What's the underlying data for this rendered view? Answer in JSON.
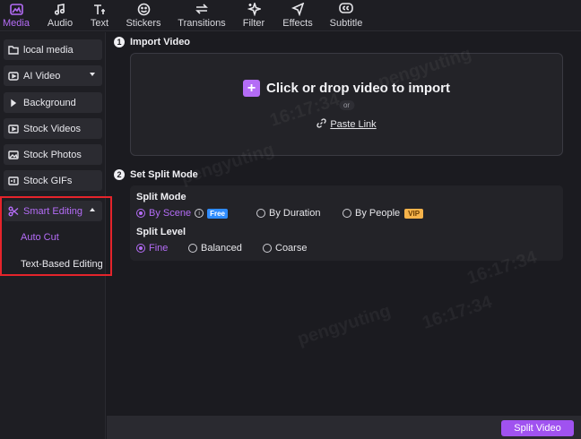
{
  "toolbar": {
    "tabs": [
      {
        "label": "Media",
        "icon": "media-icon"
      },
      {
        "label": "Audio",
        "icon": "audio-icon"
      },
      {
        "label": "Text",
        "icon": "text-icon"
      },
      {
        "label": "Stickers",
        "icon": "stickers-icon"
      },
      {
        "label": "Transitions",
        "icon": "transitions-icon"
      },
      {
        "label": "Filter",
        "icon": "filter-icon"
      },
      {
        "label": "Effects",
        "icon": "effects-icon"
      },
      {
        "label": "Subtitle",
        "icon": "subtitle-icon"
      }
    ],
    "active_tab": "Media"
  },
  "sidebar": {
    "items": [
      {
        "label": "local media",
        "icon": "folder-icon"
      },
      {
        "label": "AI Video",
        "icon": "ai-video-icon"
      },
      {
        "label": "Background",
        "icon": "triangle-right-icon"
      },
      {
        "label": "Stock Videos",
        "icon": "video-icon"
      },
      {
        "label": "Stock Photos",
        "icon": "photo-icon"
      },
      {
        "label": "Stock GIFs",
        "icon": "gif-icon"
      },
      {
        "label": "Smart Editing",
        "icon": "scissors-icon"
      }
    ],
    "sub_items": [
      {
        "label": "Auto Cut"
      },
      {
        "label": "Text-Based Editing"
      }
    ],
    "accent": "#b46cf6",
    "highlight_color": "#e5242b"
  },
  "import": {
    "step_number": "1",
    "title": "Import Video",
    "drop_text": "Click or drop video to import",
    "or_text": "or",
    "paste_link": "Paste Link"
  },
  "split": {
    "step_number": "2",
    "title": "Set Split Mode",
    "mode_label": "Split Mode",
    "mode_options": [
      {
        "label": "By Scene",
        "selected": true,
        "badge": "Free"
      },
      {
        "label": "By Duration",
        "selected": false
      },
      {
        "label": "By People",
        "selected": false,
        "badge": "VIP"
      }
    ],
    "level_label": "Split Level",
    "level_options": [
      {
        "label": "Fine",
        "selected": true
      },
      {
        "label": "Balanced",
        "selected": false
      },
      {
        "label": "Coarse",
        "selected": false
      }
    ]
  },
  "footer": {
    "split_button": "Split Video"
  },
  "watermark": {
    "name": "pengyuting",
    "time": "16:17:34"
  }
}
